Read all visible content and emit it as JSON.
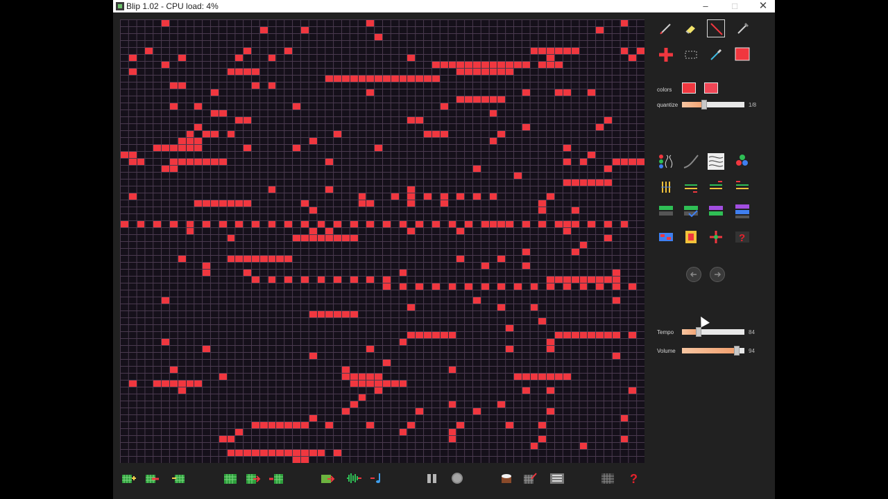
{
  "window": {
    "title": "Blip 1.02  -  CPU load: 4%",
    "minimize_glyph": "–",
    "maximize_glyph": "□",
    "close_glyph": "✕"
  },
  "palette": {
    "note": "#f0373f",
    "grid_bg": "#15101a",
    "grid_line": "#4a3a4f",
    "panel_bg": "#212121",
    "color_1": "#f0373f",
    "color_2": "#f04656"
  },
  "grid": {
    "columns": 64,
    "rows": 64,
    "active_cells": [
      [
        5,
        0
      ],
      [
        17,
        1
      ],
      [
        22,
        1
      ],
      [
        30,
        0
      ],
      [
        61,
        0
      ],
      [
        31,
        2
      ],
      [
        58,
        1
      ],
      [
        3,
        4
      ],
      [
        15,
        4
      ],
      [
        20,
        4
      ],
      [
        50,
        4
      ],
      [
        51,
        4
      ],
      [
        52,
        4
      ],
      [
        53,
        4
      ],
      [
        54,
        4
      ],
      [
        55,
        4
      ],
      [
        61,
        4
      ],
      [
        63,
        4
      ],
      [
        1,
        5
      ],
      [
        7,
        5
      ],
      [
        14,
        5
      ],
      [
        18,
        5
      ],
      [
        35,
        5
      ],
      [
        52,
        5
      ],
      [
        62,
        5
      ],
      [
        38,
        6
      ],
      [
        39,
        6
      ],
      [
        40,
        6
      ],
      [
        41,
        6
      ],
      [
        42,
        6
      ],
      [
        43,
        6
      ],
      [
        44,
        6
      ],
      [
        45,
        6
      ],
      [
        46,
        6
      ],
      [
        47,
        6
      ],
      [
        48,
        6
      ],
      [
        49,
        6
      ],
      [
        51,
        6
      ],
      [
        52,
        6
      ],
      [
        53,
        6
      ],
      [
        1,
        7
      ],
      [
        13,
        7
      ],
      [
        14,
        7
      ],
      [
        15,
        7
      ],
      [
        16,
        7
      ],
      [
        5,
        6
      ],
      [
        41,
        7
      ],
      [
        42,
        7
      ],
      [
        43,
        7
      ],
      [
        44,
        7
      ],
      [
        45,
        7
      ],
      [
        46,
        7
      ],
      [
        47,
        7
      ],
      [
        25,
        8
      ],
      [
        26,
        8
      ],
      [
        27,
        8
      ],
      [
        28,
        8
      ],
      [
        29,
        8
      ],
      [
        30,
        8
      ],
      [
        31,
        8
      ],
      [
        32,
        8
      ],
      [
        33,
        8
      ],
      [
        34,
        8
      ],
      [
        35,
        8
      ],
      [
        36,
        8
      ],
      [
        37,
        8
      ],
      [
        38,
        8
      ],
      [
        6,
        9
      ],
      [
        7,
        9
      ],
      [
        16,
        9
      ],
      [
        18,
        9
      ],
      [
        11,
        10
      ],
      [
        30,
        10
      ],
      [
        49,
        10
      ],
      [
        53,
        10
      ],
      [
        54,
        10
      ],
      [
        57,
        10
      ],
      [
        41,
        11
      ],
      [
        42,
        11
      ],
      [
        43,
        11
      ],
      [
        44,
        11
      ],
      [
        45,
        11
      ],
      [
        46,
        11
      ],
      [
        6,
        12
      ],
      [
        9,
        12
      ],
      [
        21,
        12
      ],
      [
        39,
        12
      ],
      [
        11,
        13
      ],
      [
        12,
        13
      ],
      [
        45,
        13
      ],
      [
        14,
        14
      ],
      [
        15,
        14
      ],
      [
        35,
        14
      ],
      [
        36,
        14
      ],
      [
        59,
        14
      ],
      [
        9,
        15
      ],
      [
        49,
        15
      ],
      [
        58,
        15
      ],
      [
        8,
        16
      ],
      [
        10,
        16
      ],
      [
        11,
        16
      ],
      [
        13,
        16
      ],
      [
        26,
        16
      ],
      [
        37,
        16
      ],
      [
        38,
        16
      ],
      [
        39,
        16
      ],
      [
        46,
        16
      ],
      [
        7,
        17
      ],
      [
        8,
        17
      ],
      [
        9,
        17
      ],
      [
        23,
        17
      ],
      [
        45,
        17
      ],
      [
        4,
        18
      ],
      [
        5,
        18
      ],
      [
        6,
        18
      ],
      [
        7,
        18
      ],
      [
        8,
        18
      ],
      [
        9,
        18
      ],
      [
        15,
        18
      ],
      [
        21,
        18
      ],
      [
        31,
        18
      ],
      [
        54,
        18
      ],
      [
        1,
        19
      ],
      [
        1,
        20
      ],
      [
        2,
        20
      ],
      [
        57,
        19
      ],
      [
        0,
        19
      ],
      [
        56,
        20
      ],
      [
        5,
        21
      ],
      [
        59,
        21
      ],
      [
        6,
        20
      ],
      [
        7,
        20
      ],
      [
        8,
        20
      ],
      [
        9,
        20
      ],
      [
        10,
        20
      ],
      [
        11,
        20
      ],
      [
        12,
        20
      ],
      [
        25,
        20
      ],
      [
        54,
        20
      ],
      [
        60,
        20
      ],
      [
        61,
        20
      ],
      [
        62,
        20
      ],
      [
        63,
        20
      ],
      [
        6,
        21
      ],
      [
        43,
        21
      ],
      [
        48,
        22
      ],
      [
        54,
        23
      ],
      [
        55,
        23
      ],
      [
        56,
        23
      ],
      [
        57,
        23
      ],
      [
        58,
        23
      ],
      [
        59,
        23
      ],
      [
        18,
        24
      ],
      [
        25,
        24
      ],
      [
        35,
        24
      ],
      [
        1,
        25
      ],
      [
        29,
        25
      ],
      [
        33,
        25
      ],
      [
        35,
        25
      ],
      [
        37,
        25
      ],
      [
        39,
        25
      ],
      [
        41,
        25
      ],
      [
        43,
        25
      ],
      [
        45,
        25
      ],
      [
        52,
        25
      ],
      [
        9,
        26
      ],
      [
        10,
        26
      ],
      [
        11,
        26
      ],
      [
        12,
        26
      ],
      [
        13,
        26
      ],
      [
        14,
        26
      ],
      [
        15,
        26
      ],
      [
        22,
        26
      ],
      [
        29,
        26
      ],
      [
        30,
        26
      ],
      [
        35,
        26
      ],
      [
        39,
        26
      ],
      [
        51,
        26
      ],
      [
        23,
        27
      ],
      [
        51,
        27
      ],
      [
        55,
        27
      ],
      [
        0,
        29
      ],
      [
        2,
        29
      ],
      [
        4,
        29
      ],
      [
        6,
        29
      ],
      [
        8,
        29
      ],
      [
        10,
        29
      ],
      [
        12,
        29
      ],
      [
        14,
        29
      ],
      [
        16,
        29
      ],
      [
        18,
        29
      ],
      [
        20,
        29
      ],
      [
        22,
        29
      ],
      [
        24,
        29
      ],
      [
        26,
        29
      ],
      [
        28,
        29
      ],
      [
        30,
        29
      ],
      [
        32,
        29
      ],
      [
        34,
        29
      ],
      [
        36,
        29
      ],
      [
        38,
        29
      ],
      [
        40,
        29
      ],
      [
        42,
        29
      ],
      [
        44,
        29
      ],
      [
        45,
        29
      ],
      [
        46,
        29
      ],
      [
        47,
        29
      ],
      [
        49,
        29
      ],
      [
        51,
        29
      ],
      [
        53,
        29
      ],
      [
        54,
        29
      ],
      [
        55,
        29
      ],
      [
        57,
        29
      ],
      [
        59,
        29
      ],
      [
        61,
        29
      ],
      [
        8,
        30
      ],
      [
        23,
        30
      ],
      [
        25,
        30
      ],
      [
        35,
        30
      ],
      [
        41,
        30
      ],
      [
        54,
        30
      ],
      [
        21,
        31
      ],
      [
        22,
        31
      ],
      [
        23,
        31
      ],
      [
        24,
        31
      ],
      [
        25,
        31
      ],
      [
        26,
        31
      ],
      [
        27,
        31
      ],
      [
        28,
        31
      ],
      [
        13,
        31
      ],
      [
        59,
        31
      ],
      [
        56,
        32
      ],
      [
        55,
        33
      ],
      [
        49,
        33
      ],
      [
        7,
        34
      ],
      [
        13,
        34
      ],
      [
        14,
        34
      ],
      [
        15,
        34
      ],
      [
        16,
        34
      ],
      [
        17,
        34
      ],
      [
        18,
        34
      ],
      [
        19,
        34
      ],
      [
        20,
        34
      ],
      [
        41,
        34
      ],
      [
        46,
        34
      ],
      [
        10,
        35
      ],
      [
        44,
        35
      ],
      [
        49,
        35
      ],
      [
        10,
        36
      ],
      [
        15,
        36
      ],
      [
        34,
        36
      ],
      [
        60,
        36
      ],
      [
        16,
        37
      ],
      [
        18,
        37
      ],
      [
        20,
        37
      ],
      [
        22,
        37
      ],
      [
        24,
        37
      ],
      [
        26,
        37
      ],
      [
        28,
        37
      ],
      [
        30,
        37
      ],
      [
        32,
        37
      ],
      [
        52,
        37
      ],
      [
        53,
        37
      ],
      [
        54,
        37
      ],
      [
        55,
        37
      ],
      [
        56,
        37
      ],
      [
        57,
        37
      ],
      [
        58,
        37
      ],
      [
        59,
        37
      ],
      [
        60,
        37
      ],
      [
        32,
        38
      ],
      [
        34,
        38
      ],
      [
        36,
        38
      ],
      [
        38,
        38
      ],
      [
        40,
        38
      ],
      [
        42,
        38
      ],
      [
        44,
        38
      ],
      [
        46,
        38
      ],
      [
        48,
        38
      ],
      [
        50,
        38
      ],
      [
        52,
        38
      ],
      [
        54,
        38
      ],
      [
        56,
        38
      ],
      [
        58,
        38
      ],
      [
        60,
        38
      ],
      [
        62,
        38
      ],
      [
        5,
        40
      ],
      [
        43,
        40
      ],
      [
        60,
        40
      ],
      [
        35,
        41
      ],
      [
        46,
        41
      ],
      [
        50,
        41
      ],
      [
        23,
        42
      ],
      [
        24,
        42
      ],
      [
        25,
        42
      ],
      [
        26,
        42
      ],
      [
        27,
        42
      ],
      [
        28,
        42
      ],
      [
        51,
        43
      ],
      [
        47,
        44
      ],
      [
        35,
        45
      ],
      [
        36,
        45
      ],
      [
        37,
        45
      ],
      [
        38,
        45
      ],
      [
        39,
        45
      ],
      [
        40,
        45
      ],
      [
        53,
        45
      ],
      [
        54,
        45
      ],
      [
        55,
        45
      ],
      [
        56,
        45
      ],
      [
        57,
        45
      ],
      [
        58,
        45
      ],
      [
        59,
        45
      ],
      [
        60,
        45
      ],
      [
        62,
        45
      ],
      [
        5,
        46
      ],
      [
        34,
        46
      ],
      [
        52,
        46
      ],
      [
        10,
        47
      ],
      [
        30,
        47
      ],
      [
        47,
        47
      ],
      [
        52,
        47
      ],
      [
        23,
        48
      ],
      [
        60,
        48
      ],
      [
        32,
        49
      ],
      [
        6,
        50
      ],
      [
        27,
        50
      ],
      [
        40,
        50
      ],
      [
        27,
        51
      ],
      [
        28,
        51
      ],
      [
        29,
        51
      ],
      [
        30,
        51
      ],
      [
        31,
        51
      ],
      [
        12,
        51
      ],
      [
        48,
        51
      ],
      [
        49,
        51
      ],
      [
        50,
        51
      ],
      [
        51,
        51
      ],
      [
        52,
        51
      ],
      [
        53,
        51
      ],
      [
        54,
        51
      ],
      [
        1,
        52
      ],
      [
        4,
        52
      ],
      [
        5,
        52
      ],
      [
        6,
        52
      ],
      [
        7,
        52
      ],
      [
        8,
        52
      ],
      [
        9,
        52
      ],
      [
        28,
        52
      ],
      [
        29,
        52
      ],
      [
        30,
        52
      ],
      [
        31,
        52
      ],
      [
        32,
        52
      ],
      [
        33,
        52
      ],
      [
        34,
        52
      ],
      [
        7,
        53
      ],
      [
        31,
        53
      ],
      [
        49,
        53
      ],
      [
        52,
        53
      ],
      [
        62,
        53
      ],
      [
        29,
        54
      ],
      [
        28,
        55
      ],
      [
        40,
        55
      ],
      [
        46,
        55
      ],
      [
        27,
        56
      ],
      [
        36,
        56
      ],
      [
        43,
        56
      ],
      [
        52,
        56
      ],
      [
        23,
        57
      ],
      [
        61,
        57
      ],
      [
        16,
        58
      ],
      [
        17,
        58
      ],
      [
        18,
        58
      ],
      [
        19,
        58
      ],
      [
        20,
        58
      ],
      [
        21,
        58
      ],
      [
        22,
        58
      ],
      [
        25,
        58
      ],
      [
        30,
        58
      ],
      [
        35,
        58
      ],
      [
        41,
        58
      ],
      [
        47,
        58
      ],
      [
        51,
        58
      ],
      [
        14,
        59
      ],
      [
        34,
        59
      ],
      [
        40,
        59
      ],
      [
        12,
        60
      ],
      [
        13,
        60
      ],
      [
        40,
        60
      ],
      [
        51,
        60
      ],
      [
        61,
        60
      ],
      [
        50,
        61
      ],
      [
        56,
        61
      ],
      [
        13,
        62
      ],
      [
        14,
        62
      ],
      [
        15,
        62
      ],
      [
        16,
        62
      ],
      [
        17,
        62
      ],
      [
        18,
        62
      ],
      [
        19,
        62
      ],
      [
        20,
        62
      ],
      [
        21,
        62
      ],
      [
        22,
        62
      ],
      [
        23,
        62
      ],
      [
        24,
        62
      ],
      [
        26,
        62
      ],
      [
        21,
        63
      ],
      [
        22,
        63
      ]
    ]
  },
  "toolbar": {
    "tools_row1": [
      {
        "name": "pencil-tool",
        "icon": "pencil-icon",
        "selected": false
      },
      {
        "name": "eraser-tool",
        "icon": "eraser-icon",
        "selected": false
      },
      {
        "name": "line-tool",
        "icon": "line-icon",
        "selected": true
      },
      {
        "name": "pick-tool",
        "icon": "needle-icon",
        "selected": false
      }
    ],
    "tools_row2": [
      {
        "name": "add-tool",
        "icon": "plus-icon"
      },
      {
        "name": "select-tool",
        "icon": "marquee-icon"
      },
      {
        "name": "dropper-tool",
        "icon": "dropper-icon"
      },
      {
        "name": "current-color",
        "icon": "color-square-icon"
      }
    ]
  },
  "controls": {
    "colors_label": "colors",
    "quantize_label": "quantize",
    "quantize_value": "1/8",
    "quantize_level": 0.35,
    "tempo_label": "Tempo",
    "tempo_value": "84",
    "tempo_level": 0.27,
    "volume_label": "Volume",
    "volume_value": "94",
    "volume_level": 0.88
  },
  "bottom_icons": [
    "grid-add-icon",
    "grid-shift-icon",
    "grid-move-icon",
    "pattern-green-icon",
    "pattern-arrow-icon",
    "pattern-red-icon",
    "export-image-icon",
    "waveform-icon",
    "music-note-icon",
    "pause-icon",
    "record-icon",
    "drum-icon",
    "grid-pencil-icon",
    "list-icon",
    "grid-icon",
    "help-icon"
  ]
}
